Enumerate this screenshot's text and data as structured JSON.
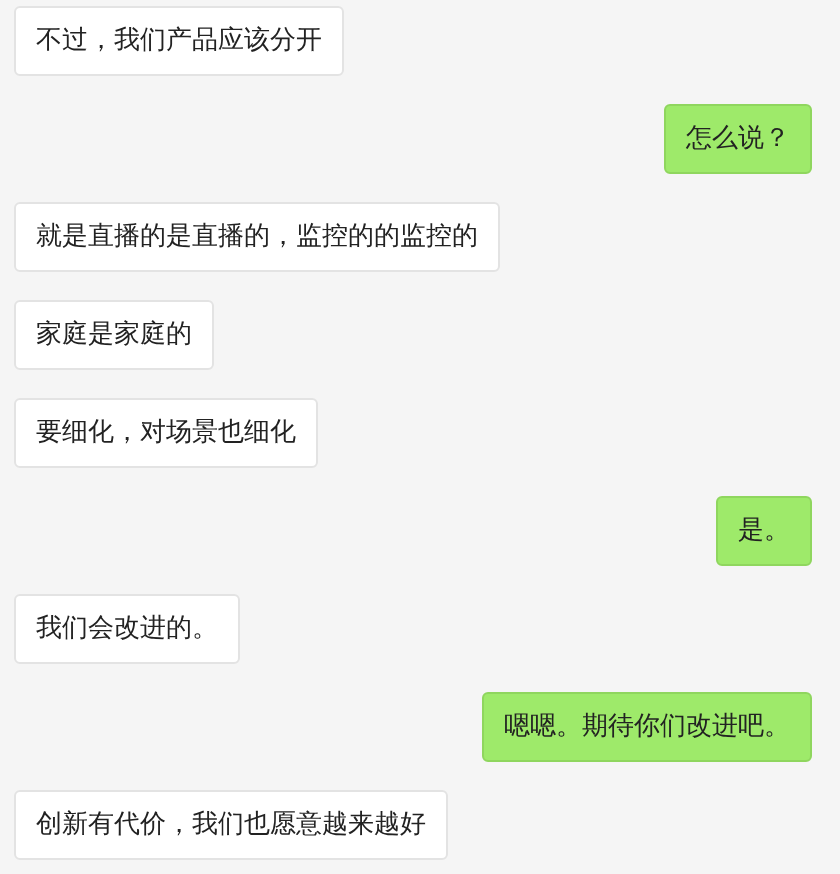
{
  "messages": [
    {
      "kind": "received",
      "text": "不过，我们产品应该分开"
    },
    {
      "kind": "sent",
      "text": "怎么说？"
    },
    {
      "kind": "received",
      "text": "就是直播的是直播的，监控的的监控的"
    },
    {
      "kind": "received",
      "text": "家庭是家庭的"
    },
    {
      "kind": "received",
      "text": "要细化，对场景也细化"
    },
    {
      "kind": "sent",
      "text": "是。"
    },
    {
      "kind": "received",
      "text": "我们会改进的。"
    },
    {
      "kind": "sent",
      "text": "嗯嗯。期待你们改进吧。"
    },
    {
      "kind": "received",
      "text": "创新有代价，我们也愿意越来越好"
    }
  ]
}
